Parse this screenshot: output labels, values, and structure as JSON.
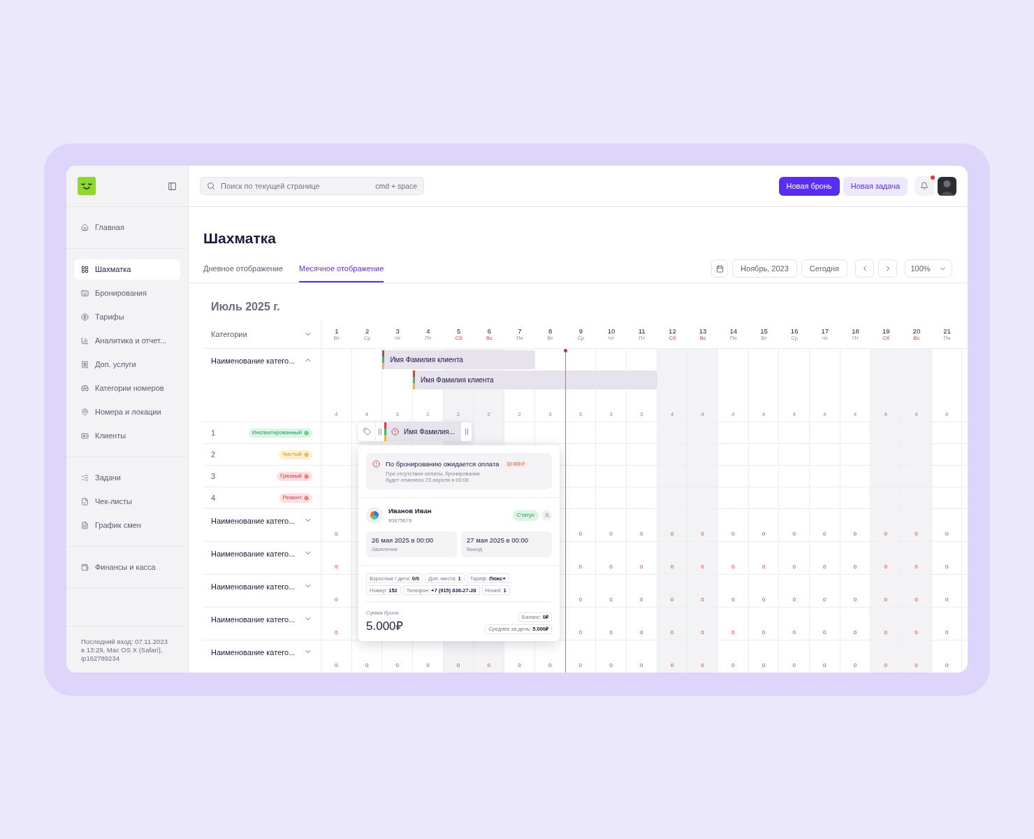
{
  "sidebar": {
    "groups": [
      {
        "items": [
          {
            "label": "Главная",
            "selected": false
          }
        ]
      },
      {
        "items": [
          {
            "label": "Шахматка",
            "selected": true
          },
          {
            "label": "Бронирования",
            "selected": false
          },
          {
            "label": "Тарифы",
            "selected": false
          },
          {
            "label": "Аналитика и отчет...",
            "selected": false
          },
          {
            "label": "Доп. услуги",
            "selected": false
          },
          {
            "label": "Категории номеров",
            "selected": false
          },
          {
            "label": "Номера и локации",
            "selected": false
          },
          {
            "label": "Клиенты",
            "selected": false
          }
        ]
      },
      {
        "items": [
          {
            "label": "Задачи",
            "selected": false
          },
          {
            "label": "Чек-листы",
            "selected": false
          },
          {
            "label": "График смен",
            "selected": false
          }
        ]
      },
      {
        "items": [
          {
            "label": "Финансы и касса",
            "selected": false
          }
        ]
      }
    ],
    "footer": "Последний вход: 07.11.2023 в 13:29, Mac OS X (Safari), ip162789234"
  },
  "topbar": {
    "search": {
      "placeholder": "Поиск по текущей странице",
      "shortcut": "cmd + space"
    },
    "buttons": [
      {
        "label": "Новая бронь",
        "kind": "primary"
      },
      {
        "label": "Новая задача",
        "kind": "secondary"
      }
    ],
    "notifications": {
      "unread": true
    }
  },
  "page": {
    "title": "Шахматка",
    "tabs": [
      {
        "label": "Дневное отображение",
        "selected": false
      },
      {
        "label": "Месячное отображение",
        "selected": true
      }
    ],
    "month_picker": "Ноябрь, 2023",
    "today_button": "Сегодня",
    "zoom": "100%"
  },
  "calendar": {
    "month": "Июль 2025 г.",
    "categories_label": "Категории",
    "days": [
      {
        "num": "1",
        "dow": "Вт",
        "weekend": false
      },
      {
        "num": "2",
        "dow": "Ср",
        "weekend": false
      },
      {
        "num": "3",
        "dow": "Чт",
        "weekend": false
      },
      {
        "num": "4",
        "dow": "Пт",
        "weekend": false
      },
      {
        "num": "5",
        "dow": "Сб",
        "weekend": true
      },
      {
        "num": "6",
        "dow": "Вс",
        "weekend": true
      },
      {
        "num": "7",
        "dow": "Пн",
        "weekend": false
      },
      {
        "num": "8",
        "dow": "Вт",
        "weekend": false
      },
      {
        "num": "9",
        "dow": "Ср",
        "weekend": false
      },
      {
        "num": "10",
        "dow": "Чт",
        "weekend": false
      },
      {
        "num": "11",
        "dow": "Пт",
        "weekend": false
      },
      {
        "num": "12",
        "dow": "Сб",
        "weekend": true
      },
      {
        "num": "13",
        "dow": "Вс",
        "weekend": true
      },
      {
        "num": "14",
        "dow": "Пн",
        "weekend": false
      },
      {
        "num": "15",
        "dow": "Вт",
        "weekend": false
      },
      {
        "num": "16",
        "dow": "Ср",
        "weekend": false
      },
      {
        "num": "17",
        "dow": "Чт",
        "weekend": false
      },
      {
        "num": "18",
        "dow": "Пт",
        "weekend": false
      },
      {
        "num": "19",
        "dow": "Сб",
        "weekend": true
      },
      {
        "num": "20",
        "dow": "Вс",
        "weekend": true
      },
      {
        "num": "21",
        "dow": "Пн",
        "weekend": false
      }
    ],
    "categories": [
      {
        "name": "Наименование катего...",
        "expanded": true,
        "sold_out": false,
        "counts_start": [
          "4",
          "4",
          "3",
          "2",
          "2",
          "2",
          "2",
          "3",
          "3",
          "3",
          "3",
          "4",
          "4",
          "4",
          "4",
          "4",
          "4",
          "4",
          "4",
          "4",
          "4"
        ],
        "bookings": [
          {
            "guest": "Имя Фамилия клиента"
          },
          {
            "guest": "Имя Фамилия клиента"
          }
        ],
        "rooms": [
          {
            "number": "1",
            "status": "Инспектированный",
            "kind": "inspected"
          },
          {
            "number": "2",
            "status": "Чистый",
            "kind": "clean"
          },
          {
            "number": "3",
            "status": "Грязный",
            "kind": "dirty"
          },
          {
            "number": "4",
            "status": "Ремонт",
            "kind": "repair"
          }
        ]
      },
      {
        "name": "Наименование катего...",
        "expanded": false,
        "sold_out": true,
        "counts_start": [
          "0"
        ],
        "counts_end": [
          "0",
          "0",
          "0",
          "0",
          "0",
          "0",
          "0",
          "0",
          "0",
          "0",
          "0",
          "0",
          "0"
        ]
      },
      {
        "name": "Наименование катего...",
        "expanded": false,
        "sold_out": true,
        "counts_start": [
          "0"
        ],
        "counts_end": [
          "0",
          "0",
          "0",
          "0",
          "0",
          "0",
          "0",
          "0",
          "0",
          "0",
          "0",
          "0",
          "0"
        ]
      },
      {
        "name": "Наименование катего...",
        "expanded": false,
        "sold_out": true,
        "counts_start": [
          "0"
        ],
        "counts_end": [
          "0",
          "0",
          "0",
          "0",
          "0",
          "0",
          "0",
          "0",
          "0",
          "0",
          "0",
          "0",
          "0"
        ]
      },
      {
        "name": "Наименование катего...",
        "expanded": false,
        "sold_out": true,
        "counts_start": [
          "0"
        ],
        "counts_end": [
          "0",
          "0",
          "0",
          "0",
          "0",
          "0",
          "0",
          "0",
          "0",
          "0",
          "0",
          "0",
          "0"
        ]
      },
      {
        "name": "Наименование катего...",
        "expanded": false,
        "sold_out": true,
        "counts_start": [
          "0",
          "0",
          "0",
          "0",
          "0",
          "0",
          "0",
          "0",
          "0",
          "0",
          "0",
          "0",
          "0",
          "0",
          "0",
          "0",
          "0",
          "0",
          "0",
          "0",
          "0"
        ]
      }
    ]
  },
  "selected_booking": {
    "guest": "Имя Фамилия...",
    "payment_overdue": true
  },
  "booking_card": {
    "alert": {
      "title": "По бронированию ожидается оплата",
      "amount": "10 000 ₽",
      "text": "При отсутствии оплаты, бронирование будет отменено 23 апреля в 00:00"
    },
    "guest": {
      "name": "Иванов Иван",
      "id": "#0875678",
      "status": "Статус"
    },
    "check_in": {
      "date": "26 мая 2025 в 00:00",
      "label": "Заселение"
    },
    "check_out": {
      "date": "27 мая 2025 в 00:00",
      "label": "Выезд"
    },
    "details": [
      {
        "label": "Взрослые / дети:",
        "value": "0/0"
      },
      {
        "label": "Доп. места:",
        "value": "1"
      },
      {
        "label": "Тариф:",
        "value": "Люкс+"
      },
      {
        "label": "Номер:",
        "value": "152"
      },
      {
        "label": "Телефон:",
        "value": "+7 (915) 836-27-28"
      },
      {
        "label": "Ночей:",
        "value": "1"
      }
    ],
    "total": {
      "label": "Сумма брони",
      "value": "5.000₽"
    },
    "balance": {
      "label": "Баланс:",
      "value": "0₽"
    },
    "average": {
      "label": "Среднее за день:",
      "value": "5.000₽"
    }
  }
}
